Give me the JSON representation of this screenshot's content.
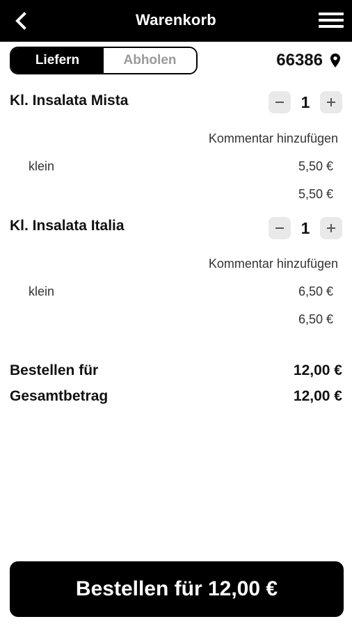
{
  "header": {
    "title": "Warenkorb",
    "back_icon": "chevron-left-icon",
    "menu_icon": "hamburger-menu-icon"
  },
  "delivery": {
    "options": [
      "Liefern",
      "Abholen"
    ],
    "selected": "Liefern",
    "zip": "66386",
    "zip_icon": "location-pin-icon"
  },
  "cart": {
    "items": [
      {
        "name": "Kl. Insalata Mista",
        "quantity": "1",
        "comment_label": "Kommentar hinzufügen",
        "variant": "klein",
        "variant_price": "5,50 €",
        "line_total": "5,50 €"
      },
      {
        "name": "Kl. Insalata Italia",
        "quantity": "1",
        "comment_label": "Kommentar hinzufügen",
        "variant": "klein",
        "variant_price": "6,50 €",
        "line_total": "6,50 €"
      }
    ]
  },
  "summary": {
    "order_for_label": "Bestellen für",
    "order_for_value": "12,00 €",
    "total_label": "Gesamtbetrag",
    "total_value": "12,00 €"
  },
  "checkout": {
    "button_label": "Bestellen für 12,00 €"
  },
  "colors": {
    "primary": "#000000",
    "background": "#ffffff",
    "button_grey": "#e9e9e9",
    "inactive_text": "#9a9a9a"
  }
}
